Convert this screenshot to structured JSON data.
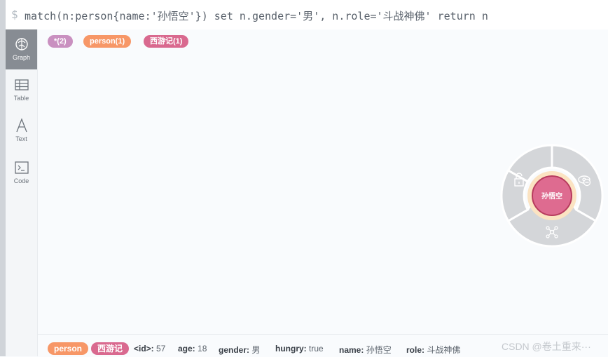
{
  "command": {
    "prompt": "$",
    "text": "match(n:person{name:'孙悟空'}) set n.gender='男', n.role='斗战神佛' return n"
  },
  "sidebar": {
    "items": [
      {
        "label": "Graph",
        "icon": "graph-icon",
        "active": true
      },
      {
        "label": "Table",
        "icon": "table-icon",
        "active": false
      },
      {
        "label": "Text",
        "icon": "text-icon",
        "active": false
      },
      {
        "label": "Code",
        "icon": "code-icon",
        "active": false
      }
    ]
  },
  "labels_bar": {
    "items": [
      {
        "text": "*(2)",
        "color": "#c990c0"
      },
      {
        "text": "person(1)",
        "color": "#f79767"
      },
      {
        "text": "西游记(1)",
        "color": "#d9698f"
      }
    ]
  },
  "graph": {
    "node": {
      "caption": "孙悟空",
      "color": "#de6b90",
      "border": "#b73b5e",
      "halo": "#fbe3c2"
    },
    "ring_color": "#d4d6d9",
    "ring_actions": [
      "lock-icon",
      "eye-off-icon",
      "expand-icon"
    ]
  },
  "footer": {
    "labels": [
      {
        "text": "person",
        "color": "#f79767"
      },
      {
        "text": "西游记",
        "color": "#d9698f"
      }
    ],
    "properties": [
      {
        "key": "<id>:",
        "value": "57"
      },
      {
        "key": "age:",
        "value": "18"
      },
      {
        "key": "gender:",
        "value": "男"
      },
      {
        "key": "hungry:",
        "value": "true"
      },
      {
        "key": "name:",
        "value": "孙悟空"
      },
      {
        "key": "role:",
        "value": "斗战神佛"
      }
    ]
  },
  "watermark": "CSDN @卷土重来···"
}
